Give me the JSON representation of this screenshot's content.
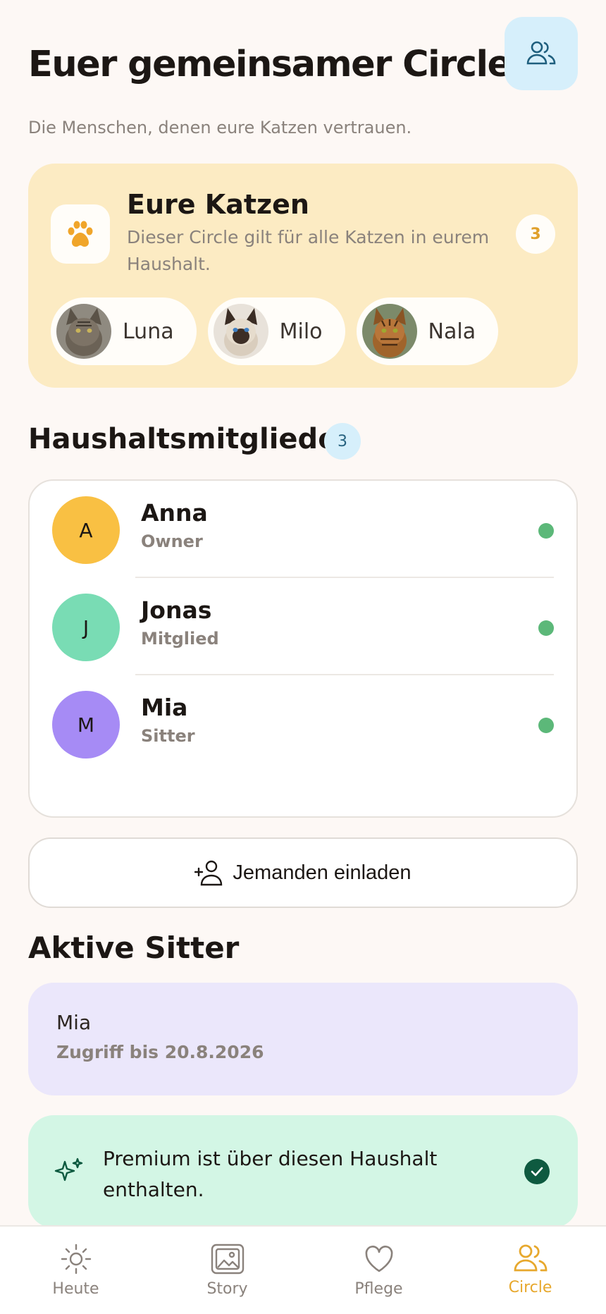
{
  "header": {
    "title": "Euer gemeinsamer Circle",
    "subtitle": "Die Menschen, denen eure Katzen vertrauen.",
    "action_icon": "people-icon"
  },
  "cats": {
    "title": "Eure Katzen",
    "description": "Dieser Circle gilt für alle Katzen in eurem Haushalt.",
    "count": "3",
    "icon": "paw-icon",
    "items": [
      {
        "name": "Luna"
      },
      {
        "name": "Milo"
      },
      {
        "name": "Nala"
      }
    ]
  },
  "members": {
    "heading": "Haushaltsmitglieder",
    "count": "3",
    "items": [
      {
        "initial": "A",
        "name": "Anna",
        "role": "Owner",
        "color": "#f9c043"
      },
      {
        "initial": "J",
        "name": "Jonas",
        "role": "Mitglied",
        "color": "#79dcb4"
      },
      {
        "initial": "M",
        "name": "Mia",
        "role": "Sitter",
        "color": "#a68bf5"
      }
    ],
    "status_color": "#5cb879"
  },
  "invite": {
    "label": "Jemanden einladen",
    "icon": "add-person-icon"
  },
  "sitters": {
    "heading": "Aktive Sitter",
    "items": [
      {
        "name": "Mia",
        "access": "Zugriff bis 20.8.2026"
      }
    ]
  },
  "premium": {
    "text": "Premium ist über diesen Haushalt enthalten.",
    "icon": "sparkles-icon",
    "status_icon": "check-icon"
  },
  "nav": {
    "items": [
      {
        "label": "Heute",
        "icon": "sun-icon"
      },
      {
        "label": "Story",
        "icon": "gallery-icon"
      },
      {
        "label": "Pflege",
        "icon": "heart-icon"
      },
      {
        "label": "Circle",
        "icon": "people-icon"
      }
    ],
    "active": "Circle",
    "active_color": "#e7a82d"
  },
  "colors": {
    "background": "#fdf8f5",
    "cats_card": "#fcebc3",
    "sitter_card": "#ebe7fb",
    "premium_card": "#d3f6e5",
    "header_button": "#d6effb"
  }
}
